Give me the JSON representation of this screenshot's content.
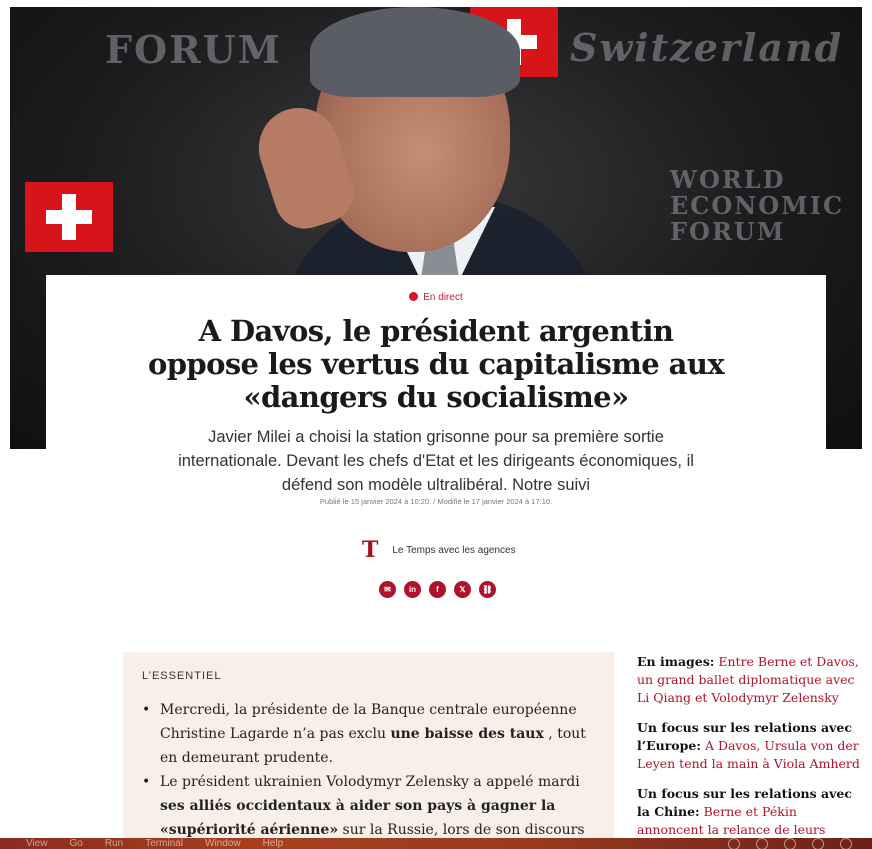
{
  "hero": {
    "watermarks": [
      "FORUM",
      "Switzerland",
      "WORLD ECONOMIC FORUM"
    ]
  },
  "article": {
    "live_label": "En direct",
    "headline": "A Davos, le président argentin oppose les vertus du capitalisme aux «dangers du socialisme»",
    "subtitle": "Javier Milei a choisi la station grisonne pour sa première sortie internationale. Devant les chefs d'Etat et les dirigeants économiques, il défend son modèle ultralibéral. Notre suivi",
    "dates": "Publié le 15 janvier 2024 à 10:20. / Modifié le 17 janvier 2024 à 17:10.",
    "author_logo": "T",
    "author": "Le Temps avec les agences",
    "share_icons": [
      "email-icon",
      "linkedin-icon",
      "facebook-icon",
      "x-icon",
      "link-icon"
    ],
    "share_glyphs": [
      "✉",
      "in",
      "f",
      "𝕏",
      "⛓"
    ]
  },
  "essentiel": {
    "title": "L’ESSENTIEL",
    "items": [
      {
        "before": "Mercredi, la présidente de la Banque centrale européenne Christine Lagarde n’a pas exclu ",
        "bold": "une baisse des taux",
        "after": " , tout en demeurant prudente."
      },
      {
        "before": "Le président ukrainien Volodymyr Zelensky a appelé mardi ",
        "bold": "ses alliés occidentaux à aider son pays à gagner la «supériorité aérienne»",
        "after": " sur la Russie, lors de son discours à Davos. Il s’était"
      }
    ]
  },
  "related": [
    {
      "label": "En images:",
      "link": "Entre Berne et Davos, un grand ballet diplomatique avec Li Qiang et Volodymyr Zelensky"
    },
    {
      "label": "Un focus sur les relations avec l’Europe:",
      "link": "A Davos, Ursula von der Leyen tend la main à Viola Amherd"
    },
    {
      "label": "Un focus sur les relations avec la Chine:",
      "link": "Berne et Pékin annoncent la relance de leurs dialogues"
    }
  ],
  "menubar": [
    "View",
    "Go",
    "Run",
    "Terminal",
    "Window",
    "Help"
  ],
  "colors": {
    "accent": "#b0122b",
    "live": "#d7142c",
    "essentiel_bg": "#f8efe9"
  }
}
